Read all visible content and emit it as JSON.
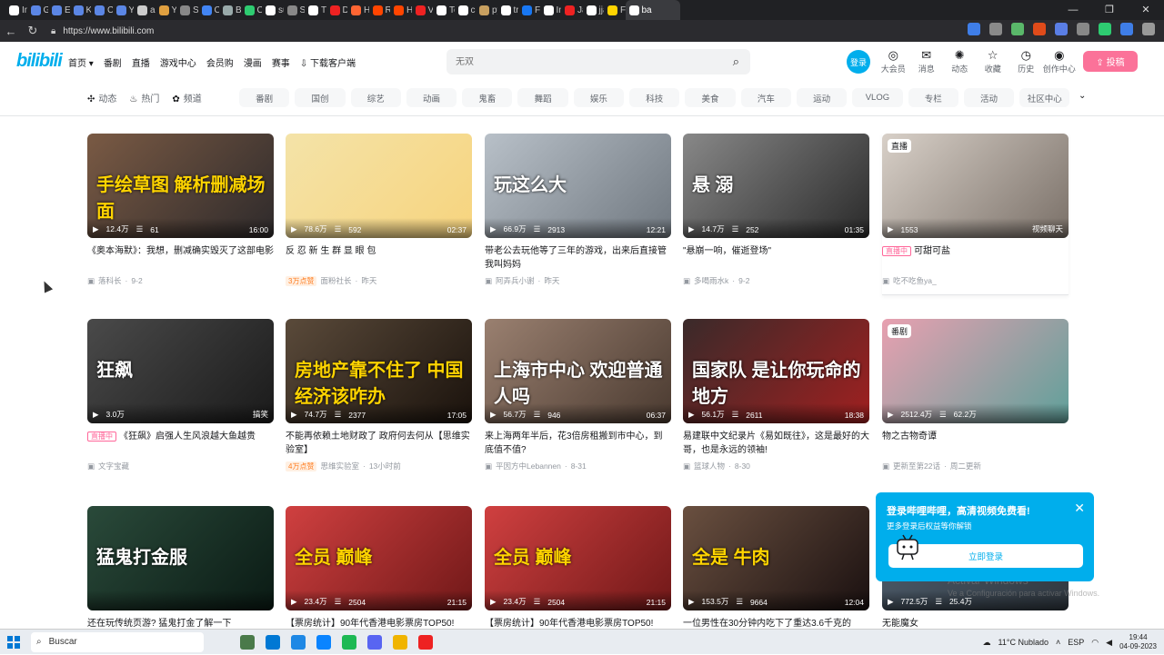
{
  "browser": {
    "tabs": [
      "Ink",
      "Gm",
      "Esc",
      "Ke",
      "Ch",
      "Yu",
      "ani",
      "Ya",
      "Site",
      "Ca",
      "Bla",
      "Ch",
      "sul",
      "Site",
      "Tik",
      "De",
      "Ho",
      "Re",
      "He",
      "Ve",
      "Tor",
      "cu",
      "py",
      "tra",
      "Fa",
      "Ini",
      "Jar",
      "jja",
      "FF",
      "ba"
    ],
    "tab_colors": [
      "#ffffff",
      "#5b86e5",
      "#5b86e5",
      "#5b86e5",
      "#5b86e5",
      "#5b86e5",
      "#cccccc",
      "#e0a040",
      "#888888",
      "#4285f4",
      "#9aa",
      "#2ecc71",
      "#ffffff",
      "#888",
      "#ffffff",
      "#e22",
      "#ff6633",
      "#ff4500",
      "#ff4500",
      "#e22",
      "#ffffff",
      "#ffffff",
      "#c8a060",
      "#ffffff",
      "#1877f2",
      "#ffffff",
      "#e22",
      "#ffffff",
      "#ffd400",
      "#ffffff"
    ],
    "active_tab": "ba",
    "url": "https://www.bilibili.com",
    "controls": [
      "—",
      "❐",
      "✕"
    ],
    "extension_colors": [
      "#3f7ee8",
      "#8a8a8a",
      "#5ab86a",
      "#e04b1a",
      "#5a7ee5",
      "#888",
      "#2ecc71",
      "#3f7ee8",
      "#999"
    ]
  },
  "header": {
    "logo": "bilibili",
    "left_nav": [
      "首页 ▾",
      "番剧",
      "直播",
      "游戏中心",
      "会员购",
      "漫画",
      "赛事",
      "⇩ 下载客户端"
    ],
    "search_placeholder": "无双",
    "login": "登录",
    "right_nav": [
      {
        "icon": "◎",
        "label": "大会员"
      },
      {
        "icon": "✉",
        "label": "消息"
      },
      {
        "icon": "✺",
        "label": "动态"
      },
      {
        "icon": "☆",
        "label": "收藏"
      },
      {
        "icon": "◷",
        "label": "历史"
      },
      {
        "icon": "◉",
        "label": "创作中心"
      }
    ],
    "upload": "⇪ 投稿"
  },
  "channel": {
    "fixed": [
      {
        "icon": "✣",
        "label": "动态"
      },
      {
        "icon": "♨",
        "label": "热门"
      },
      {
        "icon": "✿",
        "label": "频道"
      }
    ],
    "chips": [
      "番剧",
      "国创",
      "综艺",
      "动画",
      "鬼畜",
      "舞蹈",
      "娱乐",
      "科技",
      "美食",
      "汽车",
      "运动",
      "VLOG",
      "专栏",
      "活动",
      "社区中心"
    ],
    "more": "⌄"
  },
  "cards": [
    {
      "views": "12.4万",
      "danmaku": "61",
      "duration": "16:00",
      "title": "《奥本海默》：我想，删减确实毁灭了这部电影",
      "author": "落科长",
      "date": "9-2",
      "overlay": "手绘草图 解析删减场面",
      "bg": [
        "#7a5a44",
        "#2e2a2b"
      ],
      "badge": ""
    },
    {
      "views": "78.6万",
      "danmaku": "592",
      "duration": "02:37",
      "title": "反 忍 新 生 群 显 眼 包",
      "author": "面粉社长",
      "date": "昨天",
      "overlay": "",
      "bg": [
        "#f4e3a8",
        "#f7d47e"
      ],
      "badge": "3万点赞"
    },
    {
      "views": "66.9万",
      "danmaku": "2913",
      "duration": "12:21",
      "title": "带老公去玩他等了三年的游戏，出来后直接管我叫妈妈",
      "author": "阿弄兵小谢",
      "date": "昨天",
      "overlay": "玩这么大",
      "bg": [
        "#b8c0c8",
        "#707880"
      ],
      "badge": ""
    },
    {
      "views": "14.7万",
      "danmaku": "252",
      "duration": "01:35",
      "title": "\"悬崩一响，催逝登场\"",
      "author": "多喝雨水k",
      "date": "9-2",
      "overlay": "悬 溺",
      "bg": [
        "#888888",
        "#2a2a2a"
      ],
      "badge": ""
    },
    {
      "views": "1553",
      "danmaku": "",
      "duration": "视频聊天",
      "title": "可甜可盐",
      "author": "吃不吃鱼ya_",
      "date": "",
      "overlay": "",
      "bg": [
        "#d8d0c8",
        "#7a7068"
      ],
      "badge": "",
      "live": "直播中",
      "corner": "直播"
    },
    {
      "views": "3.0万",
      "danmaku": "",
      "duration": "搞笑",
      "title": "《狂飙》启强人生风浪越大鱼越贵",
      "author": "文字宝藏",
      "date": "",
      "overlay": "狂飙",
      "bg": [
        "#4a4a4a",
        "#1a1a1a"
      ],
      "badge": "",
      "live": "直播中"
    },
    {
      "views": "74.7万",
      "danmaku": "2377",
      "duration": "17:05",
      "title": "不能再依赖土地财政了 政府何去何从【思维实验室】",
      "author": "思维实验室",
      "date": "13小时前",
      "overlay": "房地产靠不住了 中国经济该咋办",
      "bg": [
        "#5a4a3a",
        "#1a120c"
      ],
      "badge": "4万点赞"
    },
    {
      "views": "56.7万",
      "danmaku": "946",
      "duration": "06:37",
      "title": "来上海两年半后，花3倍房租搬到市中心，到底值不值?",
      "author": "平因方中Lebannen",
      "date": "8-31",
      "overlay": "上海市中心 欢迎普通人吗",
      "bg": [
        "#9a8070",
        "#4a3a30"
      ],
      "badge": ""
    },
    {
      "views": "56.1万",
      "danmaku": "2611",
      "duration": "18:38",
      "title": "易建联中文纪录片《易如既往》，这是最好的大哥，也是永远的领袖!",
      "author": "篮球人物",
      "date": "8-30",
      "overlay": "国家队 是让你玩命的地方",
      "bg": [
        "#3a2a2a",
        "#a02020"
      ],
      "badge": ""
    },
    {
      "views": "2512.4万",
      "danmaku": "62.2万",
      "duration": "",
      "title": "物之古物奇谭",
      "author": "更新至第22话",
      "date": "周二更新",
      "overlay": "",
      "bg": [
        "#e8a0b0",
        "#5fa09a"
      ],
      "badge": "",
      "corner": "番剧"
    },
    {
      "views": "",
      "danmaku": "",
      "duration": "",
      "title": "还在玩传统页游? 猛鬼打金了解一下",
      "author": "",
      "date": "",
      "overlay": "猛鬼打金服",
      "bg": [
        "#2a4a3a",
        "#0a1a14"
      ],
      "badge": ""
    },
    {
      "views": "23.4万",
      "danmaku": "2504",
      "duration": "21:15",
      "title": "【票房统计】90年代香港电影票房TOP50!",
      "author": "",
      "date": "",
      "overlay": "全员 巅峰",
      "bg": [
        "#d04040",
        "#701818"
      ],
      "badge": ""
    },
    {
      "views": "23.4万",
      "danmaku": "2504",
      "duration": "21:15",
      "title": "【票房统计】90年代香港电影票房TOP50!",
      "author": "",
      "date": "",
      "overlay": "全员 巅峰",
      "bg": [
        "#d04040",
        "#701818"
      ],
      "badge": ""
    },
    {
      "views": "153.5万",
      "danmaku": "9664",
      "duration": "12:04",
      "title": "一位男性在30分钟内吃下了重达3.6千克的",
      "author": "",
      "date": "",
      "overlay": "全是 牛肉",
      "bg": [
        "#6a5040",
        "#1a1010"
      ],
      "badge": ""
    },
    {
      "views": "772.5万",
      "danmaku": "25.4万",
      "duration": "",
      "title": "无能魔女",
      "author": "",
      "date": "",
      "overlay": "",
      "bg": [
        "#506070",
        "#303840"
      ],
      "badge": ""
    }
  ],
  "popup": {
    "title": "登录哔哩哔哩，高清视频免费看!",
    "subtitle": "更多登录后权益等你解锁",
    "button": "立即登录",
    "close": "✕"
  },
  "watermark": {
    "line1": "Activar Windows",
    "line2": "Ve a Configuración para activar Windows."
  },
  "taskbar": {
    "search": "Buscar",
    "weather": "11°C  Nublado",
    "lang": "ESP",
    "time": "19:44",
    "date": "04-09-2023",
    "app_colors": [
      "#4a7a4a",
      "#0078d4",
      "#1e88e5",
      "#0a84ff",
      "#1db954",
      "#5865f2",
      "#f0b400",
      "#e22"
    ]
  }
}
